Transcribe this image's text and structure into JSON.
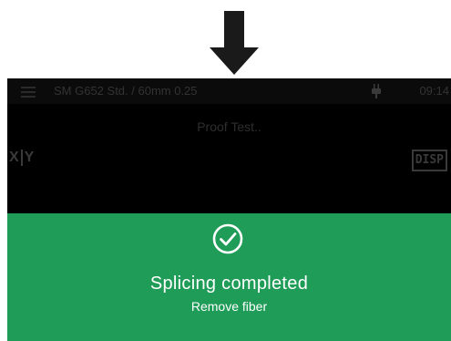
{
  "statusbar": {
    "menu_icon": "hamburger-menu-icon",
    "profile": "SM G652 Std. / 60mm 0.25",
    "power_icon": "ac-plug-icon",
    "time": "09:14"
  },
  "screen": {
    "status_message": "Proof Test..",
    "xy_button": {
      "x_label": "X",
      "y_label": "Y"
    },
    "disp_button_label": "DISP"
  },
  "result_banner": {
    "icon": "check-circle-icon",
    "title": "Splicing completed",
    "subtitle": "Remove fiber"
  },
  "pointer": {
    "icon": "down-arrow-icon"
  },
  "colors": {
    "banner_green": "#1f9c57",
    "screen_background": "#000000",
    "dim_text": "#333333",
    "arrow": "#1a1a1a"
  }
}
